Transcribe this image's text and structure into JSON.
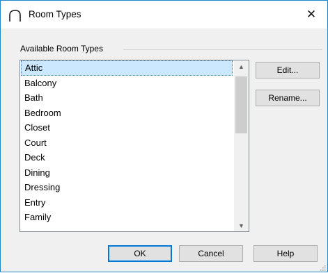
{
  "window": {
    "title": "Room Types",
    "close_glyph": "✕",
    "app_icon": "arc-icon"
  },
  "group": {
    "label": "Available Room Types"
  },
  "list": {
    "items": [
      "Attic",
      "Balcony",
      "Bath",
      "Bedroom",
      "Closet",
      "Court",
      "Deck",
      "Dining",
      "Dressing",
      "Entry",
      "Family"
    ],
    "selected": "Attic"
  },
  "scrollbar": {
    "up_glyph": "▲",
    "down_glyph": "▼"
  },
  "buttons": {
    "edit": "Edit...",
    "rename": "Rename...",
    "ok": "OK",
    "cancel": "Cancel",
    "help": "Help"
  },
  "colors": {
    "accent": "#0078d7",
    "selection": "#cce8ff",
    "window_border": "#1c85c7"
  }
}
